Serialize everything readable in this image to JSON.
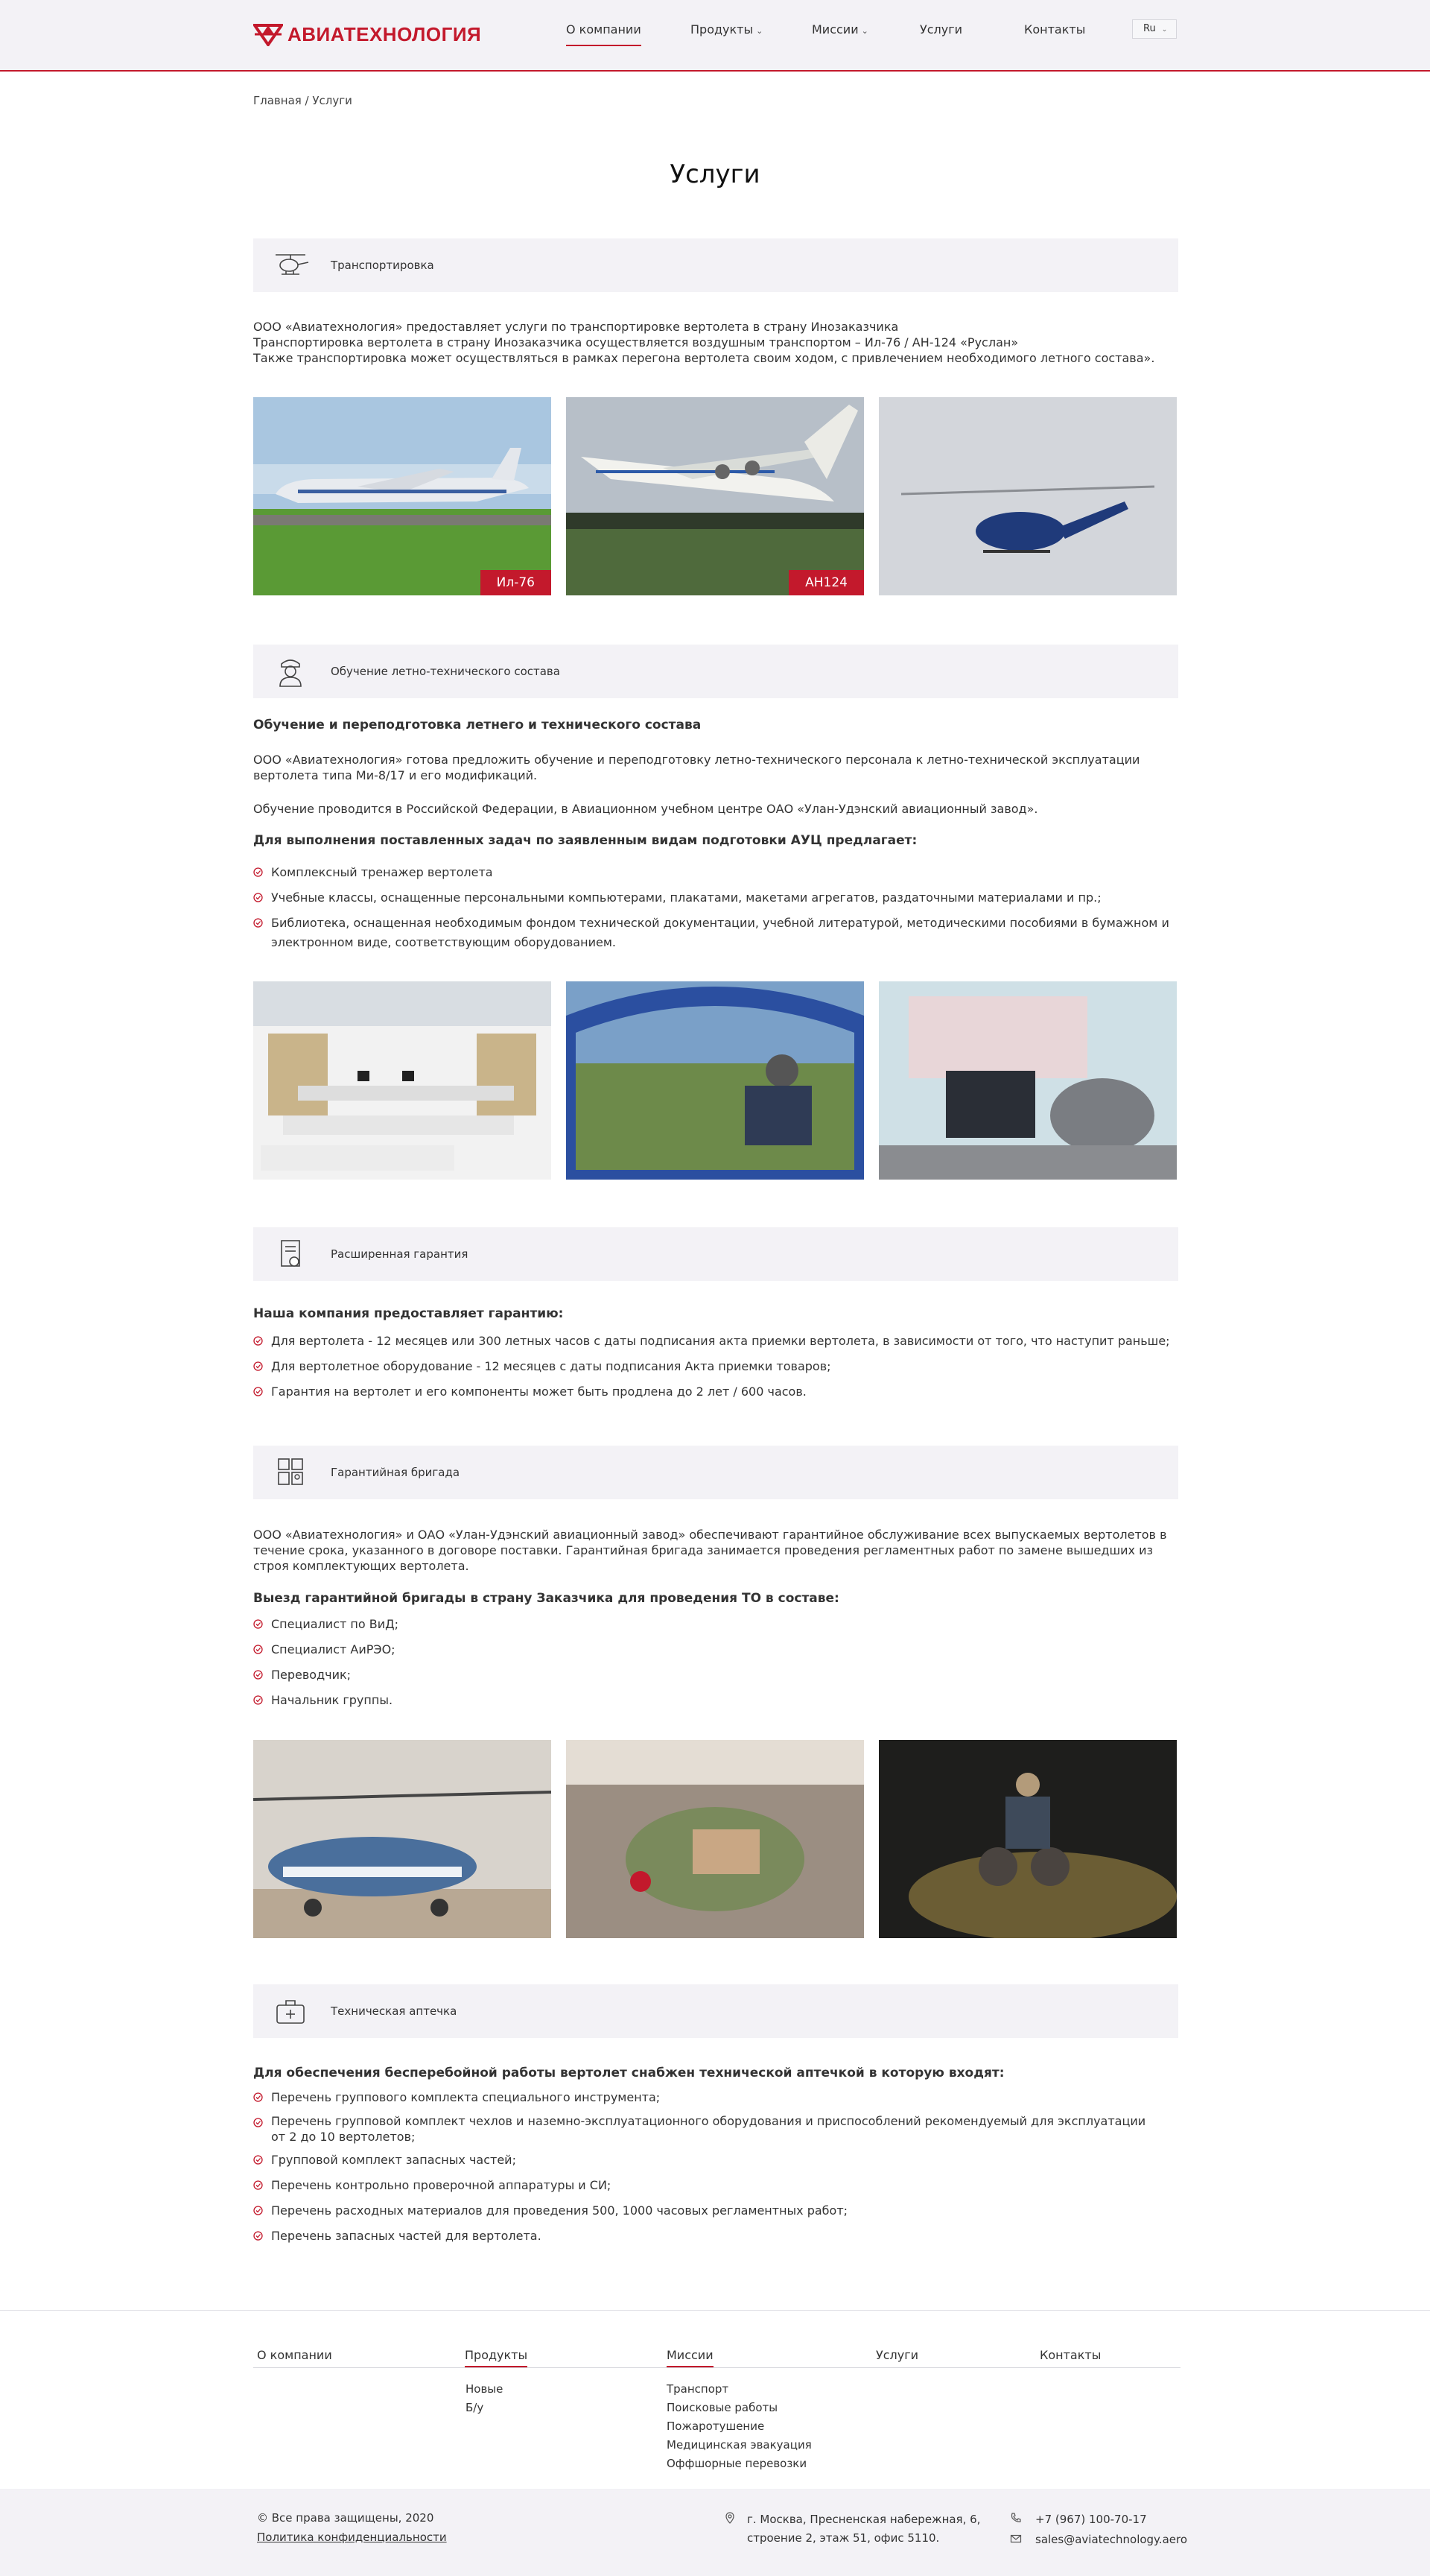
{
  "header": {
    "logo_text": "АВИАТЕХНОЛОГИЯ",
    "nav": [
      "О компании",
      "Продукты",
      "Миссии",
      "Услуги",
      "Контакты"
    ],
    "lang": "Ru"
  },
  "breadcrumb": "Главная / Услуги",
  "page_title": "Услуги",
  "sections": {
    "transport": {
      "title": "Транспортировка",
      "lines": [
        "ООО «Авиатехнология» предоставляет услуги по транспортировке вертолета в страну Инозаказчика",
        "Транспортировка вертолета в страну Инозаказчика осуществляется воздушным транспортом – Ил-76 / АН-124 «Руслан»",
        "Также транспортировка может осуществляться в рамках перегона вертолета своим ходом, с привлечением необходимого летного состава»."
      ],
      "photo_tags": [
        "Ил-76",
        "АН124"
      ]
    },
    "training": {
      "title": "Обучение летно-технического состава",
      "heading": "Обучение и переподготовка летнего и технического состава",
      "paragraph1": "ООО «Авиатехнология» готова предложить обучение и  переподготовку летно-технического персонала к летно-технической эксплуатации вертолета типа Ми-8/17 и его модификаций.",
      "paragraph2": "Обучение проводится в Российской Федерации, в Авиационном учебном центре ОАО «Улан-Удэнский авиационный завод».",
      "subheading": "Для выполнения поставленных задач по заявленным видам подготовки АУЦ предлагает:",
      "items": [
        "Комплексный тренажер вертолета",
        "Учебные классы, оснащенные персональными компьютерами, плакатами, макетами агрегатов, раздаточными материалами и пр.;",
        "Библиотека, оснащенная необходимым фондом технической документации, учебной литературой, методическими пособиями в бумажном и электронном виде, соответствующим оборудованием."
      ]
    },
    "warranty": {
      "title": "Расширенная гарантия",
      "heading": "Наша компания предоставляет гарантию:",
      "items": [
        "Для вертолета - 12 месяцев или 300 летных часов с даты подписания акта приемки вертолета, в зависимости от того, что наступит раньше;",
        "Для вертолетное оборудование - 12 месяцев с даты подписания Акта приемки товаров;",
        "Гарантия на вертолет и его компоненты может быть продлена до 2 лет / 600 часов."
      ]
    },
    "brigade": {
      "title": "Гарантийная бригада",
      "paragraph": "ООО «Авиатехнология» и ОАО «Улан-Удэнский авиационный завод» обеспечивают гарантийное обслуживание всех выпускаемых вертолетов в течение срока, указанного в договоре поставки. Гарантийная бригада занимается  проведения регламентных работ по замене вышедших из строя комплектующих вертолета.",
      "heading": "Выезд гарантийной бригады в страну Заказчика для проведения ТО в составе:",
      "items": [
        "Специалист по ВиД;",
        "Специалист АиРЭО;",
        "Переводчик;",
        "Начальник группы."
      ]
    },
    "kit": {
      "title": "Техническая аптечка",
      "heading": "Для обеспечения бесперебойной работы вертолет снабжен технической аптечкой в которую входят:",
      "items": [
        "Перечень группового комплекта специального инструмента;",
        "Перечень  групповой комплект чехлов и наземно-эксплуатационного оборудования и приспособлений рекомендуемый для эксплуатации от 2 до 10 вертолетов;",
        "Групповой комплект запасных частей;",
        "Перечень контрольно проверочной аппаратуры и СИ;",
        "Перечень расходных материалов для проведения 500, 1000 часовых регламентных работ;",
        "Перечень запасных частей для вертолета."
      ]
    }
  },
  "footer": {
    "columns": [
      "О компании",
      "Продукты",
      "Миссии",
      "Услуги",
      "Контакты"
    ],
    "products": [
      "Новые",
      "Б/у"
    ],
    "missions": [
      "Транспорт",
      "Поисковые работы",
      "Пожаротушение",
      "Медицинская эвакуация",
      "Оффшорные перевозки"
    ],
    "copyright": "© Все права защищены, 2020",
    "privacy": "Политика конфиденциальности",
    "address_line1": "г. Москва, Пресненская набережная, 6,",
    "address_line2": "строение 2, этаж 51, офис 5110.",
    "phone": "+7 (967) 100-70-17",
    "email": "sales@aviatechnology.aero"
  },
  "colors": {
    "accent": "#c3192c",
    "panel": "#f3f2f6"
  }
}
